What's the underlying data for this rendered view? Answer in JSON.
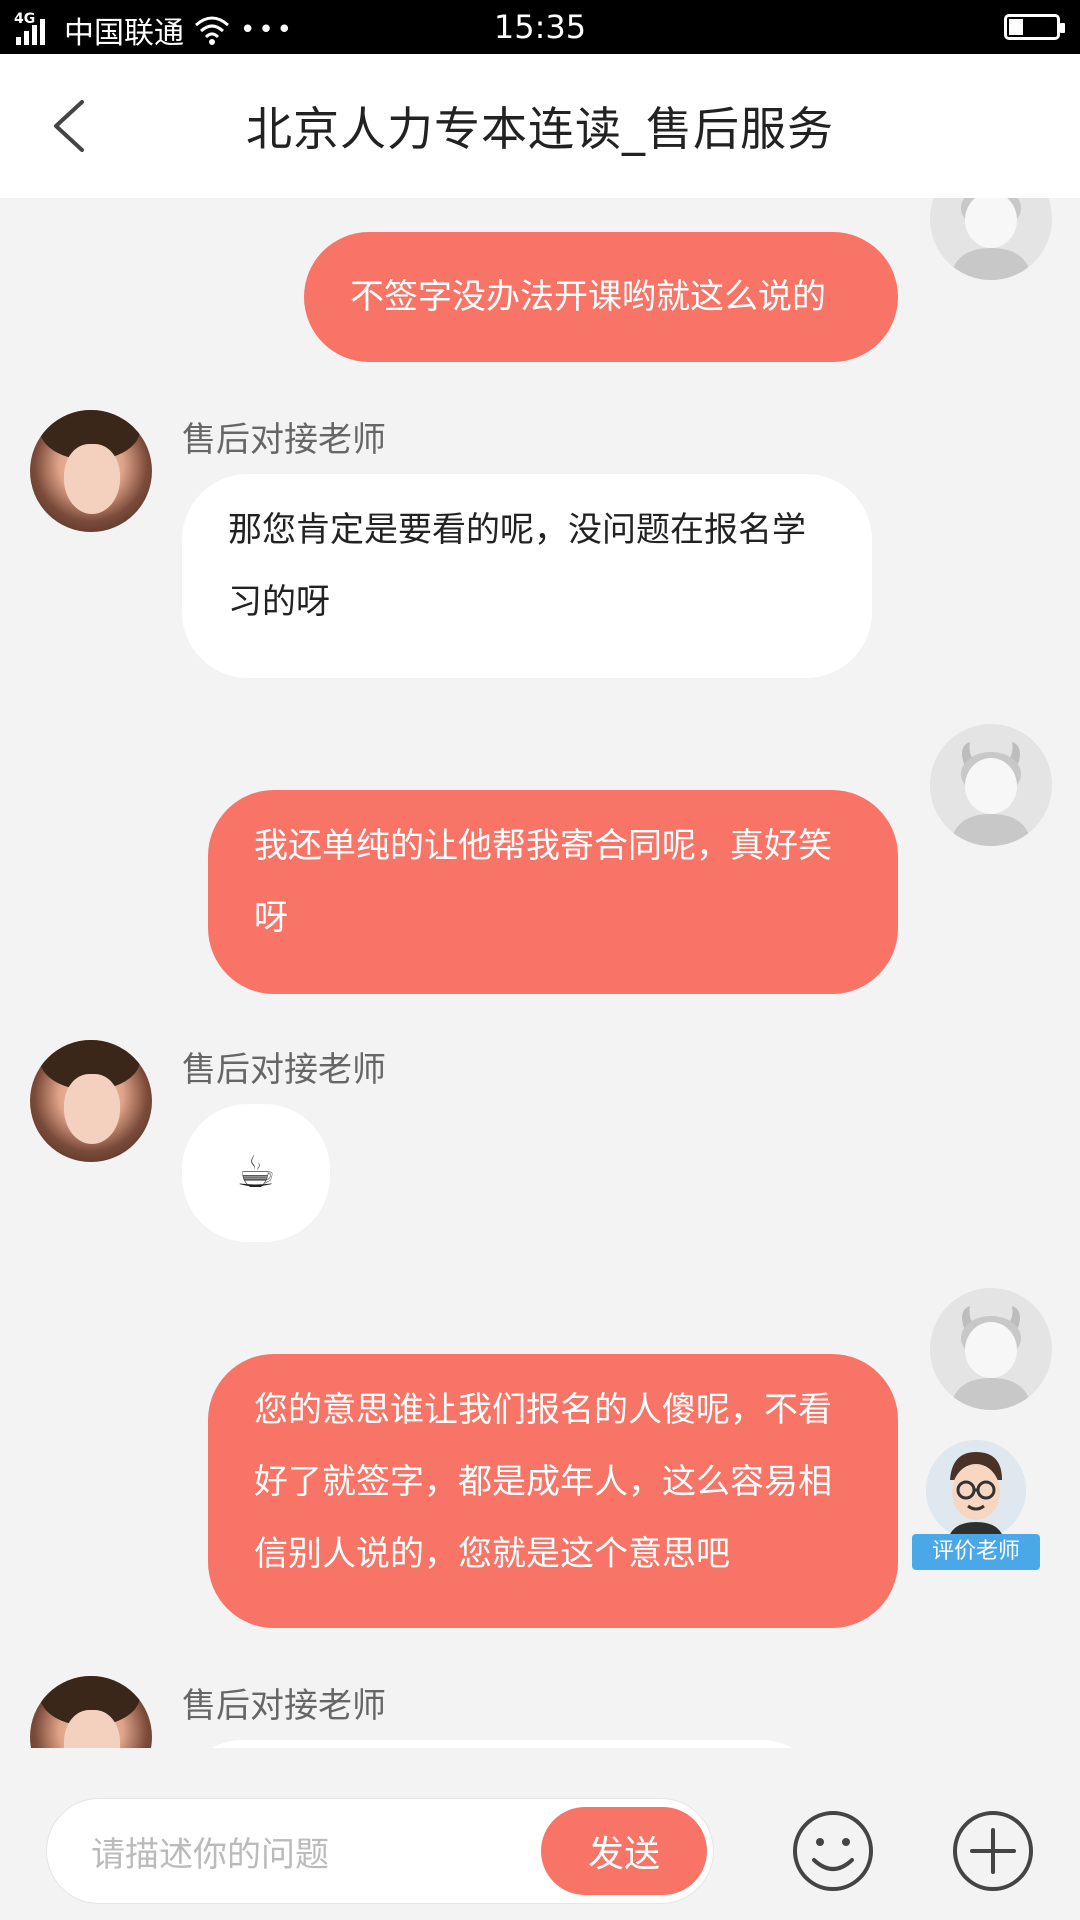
{
  "status_bar": {
    "network": "4G",
    "carrier": "中国联通",
    "dots": "•••",
    "time": "15:35"
  },
  "header": {
    "title": "北京人力专本连读_售后服务"
  },
  "messages": [
    {
      "side": "out",
      "text": "不签字没办法开课哟就这么说的"
    },
    {
      "side": "in",
      "sender": "售后对接老师",
      "text": "那您肯定是要看的呢，没问题在报名学习的呀"
    },
    {
      "side": "out",
      "text": "我还单纯的让他帮我寄合同呢，真好笑呀"
    },
    {
      "side": "in",
      "sender": "售后对接老师",
      "emoji": "☕"
    },
    {
      "side": "out",
      "text": "您的意思谁让我们报名的人傻呢，不看好了就签字，都是成年人，这么容易相信别人说的，您就是这个意思吧"
    },
    {
      "side": "in",
      "sender": "售后对接老师"
    }
  ],
  "rate_widget": {
    "label": "评价老师"
  },
  "input_bar": {
    "placeholder": "请描述你的问题",
    "send_label": "发送"
  },
  "colors": {
    "accent": "#f87466",
    "background": "#f3f3f3"
  }
}
